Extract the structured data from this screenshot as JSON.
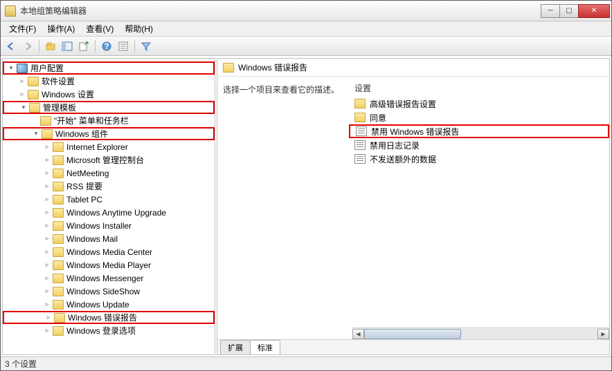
{
  "window": {
    "title": "本地组策略编辑器"
  },
  "menu": {
    "file": "文件(F)",
    "action": "操作(A)",
    "view": "查看(V)",
    "help": "帮助(H)"
  },
  "tree": {
    "root": "用户配置",
    "software": "软件设置",
    "winsettings": "Windows 设置",
    "admin": "管理模板",
    "startmenu": "\"开始\" 菜单和任务栏",
    "wincomp": "Windows 组件",
    "items": [
      "Internet Explorer",
      "Microsoft 管理控制台",
      "NetMeeting",
      "RSS 提要",
      "Tablet PC",
      "Windows Anytime Upgrade",
      "Windows Installer",
      "Windows Mail",
      "Windows Media Center",
      "Windows Media Player",
      "Windows Messenger",
      "Windows SideShow",
      "Windows Update",
      "Windows 错误报告",
      "Windows 登录选项"
    ]
  },
  "right": {
    "header": "Windows 错误报告",
    "instruction": "选择一个项目来查看它的描述。",
    "col": "设置",
    "settings": [
      "高级错误报告设置",
      "同意",
      "禁用 Windows 错误报告",
      "禁用日志记录",
      "不发送额外的数据"
    ],
    "tabs": {
      "ext": "扩展",
      "std": "标准"
    }
  },
  "status": "3 个设置"
}
